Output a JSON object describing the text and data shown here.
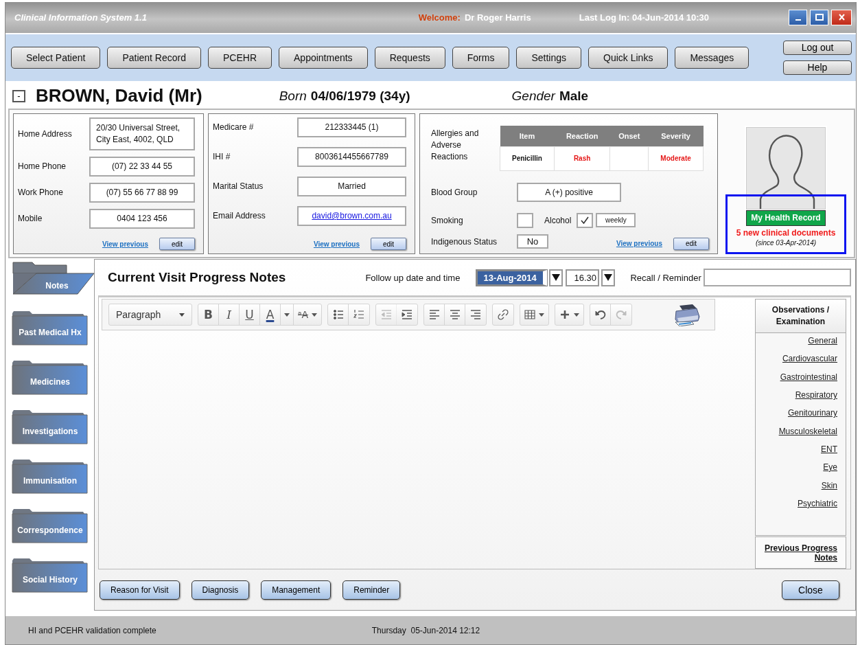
{
  "window": {
    "title": "Clinical Information System 1.1",
    "welcome_label": "Welcome:",
    "user": "Dr Roger Harris",
    "last_login": "Last Log In: 04-Jun-2014 10:30"
  },
  "nav": {
    "buttons": [
      "Select Patient",
      "Patient Record",
      "PCEHR",
      "Appointments",
      "Requests",
      "Forms",
      "Settings",
      "Quick Links",
      "Messages"
    ],
    "side_buttons": [
      "Log out",
      "Help"
    ]
  },
  "patient": {
    "collapse": "-",
    "name": "BROWN, David (Mr)",
    "born_label": "Born",
    "born": "04/06/1979 (34y)",
    "gender_label": "Gender",
    "gender": "Male"
  },
  "contact_card": {
    "fields": [
      {
        "label": "Home Address",
        "value": "20/30 Universal Street, City East, 4002, QLD",
        "kind": "address"
      },
      {
        "label": "Home Phone",
        "value": "(07) 22 33 44  55",
        "kind": "text"
      },
      {
        "label": "Work Phone",
        "value": "(07) 55 66 77 88 99",
        "kind": "text"
      },
      {
        "label": "Mobile",
        "value": "0404 123 456",
        "kind": "text"
      }
    ],
    "link": "View previous",
    "button": "edit"
  },
  "id_card": {
    "fields": [
      {
        "label": "Medicare #",
        "value": "212333445 (1)",
        "kind": "text"
      },
      {
        "label": "IHI #",
        "value": "8003614455667789",
        "kind": "text"
      },
      {
        "label": "Marital Status",
        "value": "Married",
        "kind": "text"
      },
      {
        "label": "Email Address",
        "value": "david@brown.com.au",
        "kind": "link"
      }
    ],
    "link": "View previous",
    "button": "edit"
  },
  "clinical_card": {
    "allergies_label": "Allergies and Adverse Reactions",
    "allergy_columns": [
      "Item",
      "Reaction",
      "Onset",
      "Severity"
    ],
    "allergy_rows": [
      {
        "item": "Penicillin",
        "reaction": "Rash",
        "severity": "Moderate"
      }
    ],
    "blood_group_label": "Blood Group",
    "blood_group": "A (+) positive",
    "smoking": {
      "label": "Smoking",
      "checked": false
    },
    "alcohol": {
      "label": "Alcohol",
      "checked": true,
      "frequency": "weekly"
    },
    "indigenous_label": "Indigenous Status",
    "indigenous": "No",
    "link": "View previous",
    "button": "edit"
  },
  "health_record": {
    "button": "My Health Record",
    "notice": "5 new clinical documents",
    "since": "(since 03-Apr-2014)"
  },
  "tabs": [
    {
      "label": "Notes",
      "selected": true
    },
    {
      "label": "Past Medical Hx",
      "selected": false
    },
    {
      "label": "Medicines",
      "selected": false
    },
    {
      "label": "Investigations",
      "selected": false
    },
    {
      "label": "Immunisation",
      "selected": false
    },
    {
      "label": "Correspondence",
      "selected": false
    },
    {
      "label": "Social History",
      "selected": false
    }
  ],
  "notes": {
    "title": "Current Visit Progress Notes",
    "follow_up_label": "Follow up date and time",
    "date": "13-Aug-2014",
    "time": "16.30",
    "recall_label": "Recall / Reminder"
  },
  "toolbar": {
    "format": "Paragraph",
    "groups": [
      [
        {
          "kind": "bold",
          "glyph": "B",
          "disabled": false
        },
        {
          "kind": "italic",
          "glyph": "I",
          "disabled": false
        },
        {
          "kind": "underline",
          "glyph": "U",
          "disabled": false
        },
        {
          "kind": "color",
          "glyph": "A",
          "disabled": false
        },
        {
          "kind": "size",
          "glyph": "ᵃA",
          "disabled": false
        }
      ],
      [
        {
          "kind": "bullets",
          "disabled": false
        },
        {
          "kind": "numbers",
          "disabled": false
        }
      ],
      [
        {
          "kind": "outdent",
          "disabled": true
        },
        {
          "kind": "indent",
          "disabled": false
        }
      ],
      [
        {
          "kind": "align-left",
          "disabled": false
        },
        {
          "kind": "align-center",
          "disabled": false
        },
        {
          "kind": "align-right",
          "disabled": false
        }
      ],
      [
        {
          "kind": "link",
          "disabled": false
        }
      ],
      [
        {
          "kind": "table",
          "disabled": false
        }
      ],
      [
        {
          "kind": "insert",
          "disabled": false
        }
      ],
      [
        {
          "kind": "undo",
          "disabled": false
        },
        {
          "kind": "redo",
          "disabled": true
        }
      ]
    ]
  },
  "observations": {
    "title": "Observations / Examination",
    "links": [
      "General",
      "Cardiovascular",
      "Gastrointestinal",
      "Respiratory",
      "Genitourinary",
      "Musculoskeletal",
      "ENT",
      "Eye",
      "Skin",
      "Psychiatric"
    ],
    "previous": "Previous Progress Notes"
  },
  "actions": [
    "Reason for Visit",
    "Diagnosis",
    "Management",
    "Reminder"
  ],
  "close": "Close",
  "status_bar": {
    "message": "HI and PCEHR validation complete",
    "datetime": "Thursday  05-Jun-2014 12:12"
  }
}
